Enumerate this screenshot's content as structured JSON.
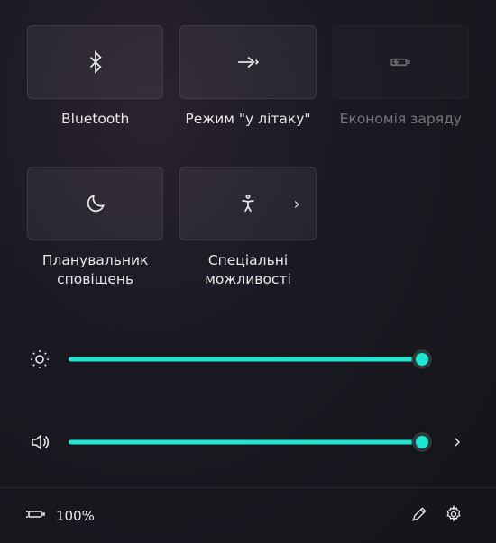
{
  "tiles": [
    {
      "label": "Bluetooth"
    },
    {
      "label": "Режим \"у літаку\""
    },
    {
      "label": "Економія заряду"
    },
    {
      "label": "Планувальник сповіщень"
    },
    {
      "label": "Спеціальні можливості"
    }
  ],
  "sliders": {
    "brightness": {
      "percent": 98
    },
    "volume": {
      "percent": 98
    }
  },
  "footer": {
    "battery_text": "100%"
  },
  "accent": "#1fe6d0"
}
